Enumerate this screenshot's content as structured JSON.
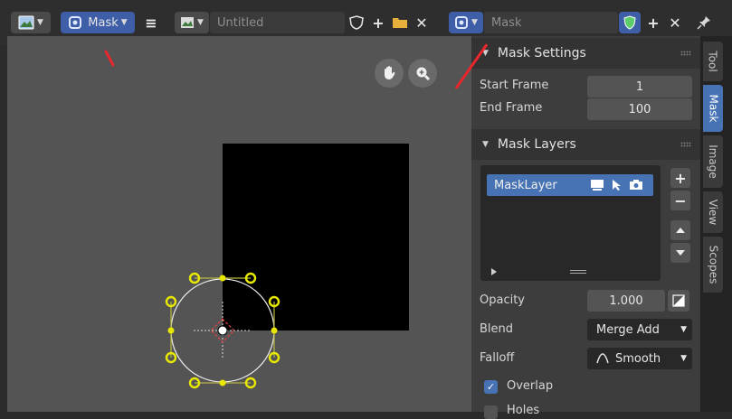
{
  "header": {
    "left_editor": {
      "mode_label": "Mask",
      "image_name": "Untitled"
    },
    "right_editor": {
      "mask_name": "Mask"
    }
  },
  "viewport": {
    "tools": [
      "hand-icon",
      "zoom-icon"
    ]
  },
  "sidebar": {
    "mask_settings": {
      "title": "Mask Settings",
      "start_frame_label": "Start Frame",
      "start_frame_value": "1",
      "end_frame_label": "End Frame",
      "end_frame_value": "100"
    },
    "mask_layers": {
      "title": "Mask Layers",
      "layers": [
        {
          "name": "MaskLayer"
        }
      ],
      "opacity_label": "Opacity",
      "opacity_value": "1.000",
      "blend_label": "Blend",
      "blend_value": "Merge Add",
      "falloff_label": "Falloff",
      "falloff_value": "Smooth",
      "overlap_label": "Overlap",
      "overlap_checked": true,
      "holes_label": "Holes",
      "holes_checked": false
    }
  },
  "tabs": [
    "Tool",
    "Mask",
    "Image",
    "View",
    "Scopes"
  ],
  "active_tab": "Mask",
  "colors": {
    "accent": "#4772b3",
    "mask_point": "#e8e800",
    "annotation": "#e8262b"
  }
}
